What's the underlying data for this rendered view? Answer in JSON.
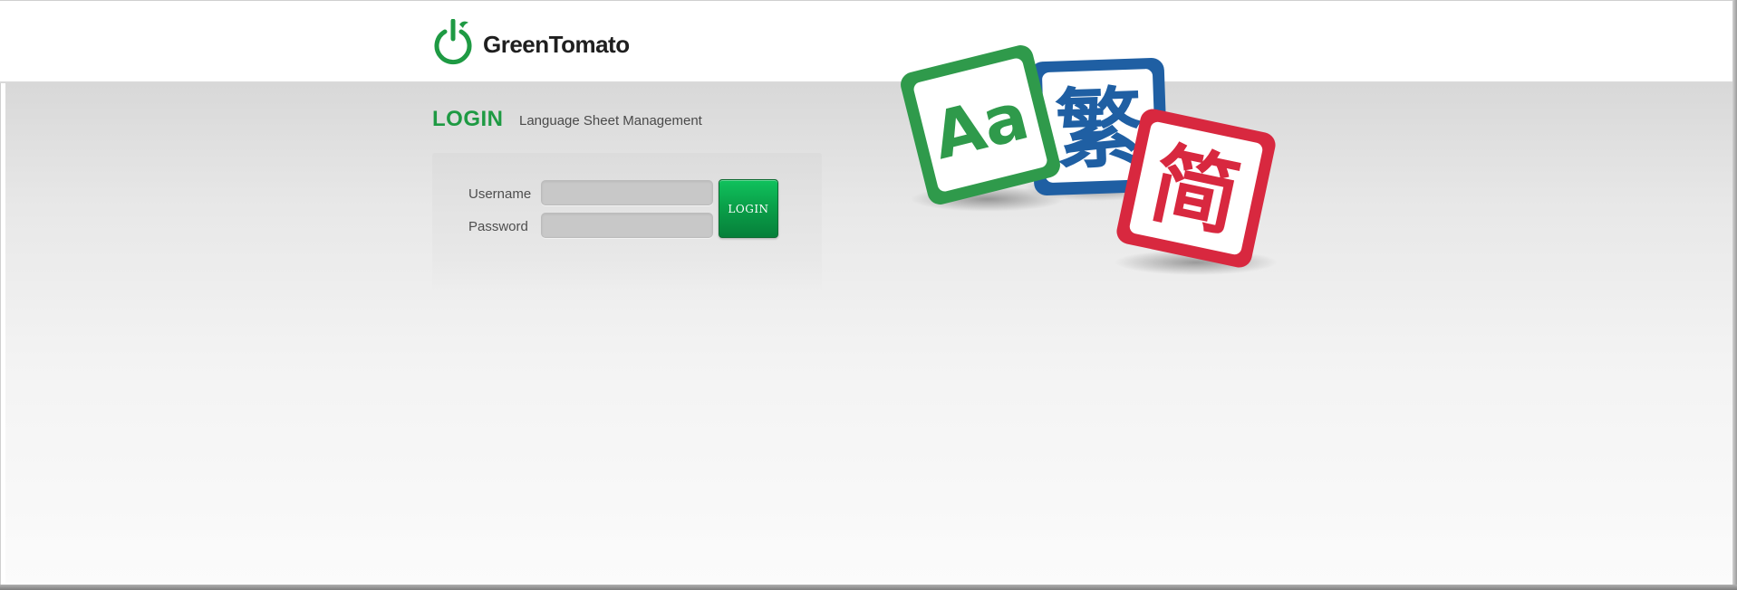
{
  "brand": {
    "name": "GreenTomato",
    "icon": "power-icon",
    "color": "#1e9a43"
  },
  "login": {
    "heading": "LOGIN",
    "subtitle": "Language Sheet Management",
    "username_label": "Username",
    "password_label": "Password",
    "username_value": "",
    "password_value": "",
    "button_label": "LOGIN"
  },
  "illustration": {
    "tiles": [
      {
        "text": "Aa",
        "color": "#2f9a4b",
        "icon": "latin-tile"
      },
      {
        "text": "繁",
        "color": "#1f5fa3",
        "icon": "traditional-chinese-tile"
      },
      {
        "text": "简",
        "color": "#d8283f",
        "icon": "simplified-chinese-tile"
      }
    ]
  }
}
